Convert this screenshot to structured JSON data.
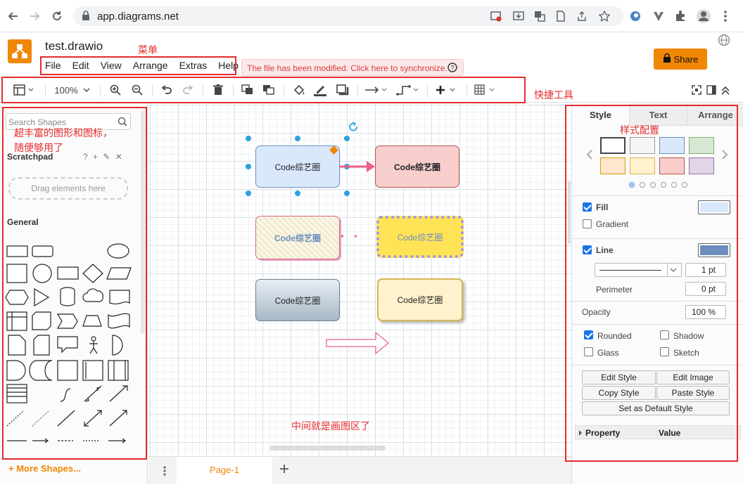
{
  "browser": {
    "url": "app.diagrams.net"
  },
  "app": {
    "file_title": "test.drawio",
    "menu": [
      "File",
      "Edit",
      "View",
      "Arrange",
      "Extras",
      "Help"
    ],
    "sync_message": "The file has been modified. Click here to synchronize.",
    "share_label": "Share",
    "accent_color": "#f08705"
  },
  "toolbar": {
    "zoom": "100%"
  },
  "sidebar": {
    "search_placeholder": "Search Shapes",
    "scratchpad_label": "Scratchpad",
    "scratchpad_actions": "? + ✎ ✕",
    "drag_hint": "Drag elements here",
    "general_label": "General",
    "more_shapes": "+ More Shapes..."
  },
  "canvas": {
    "shape_text": "Code综艺圈",
    "page_tab": "Page-1"
  },
  "panel": {
    "tabs": [
      "Style",
      "Text",
      "Arrange"
    ],
    "swatches_row1": [
      "#ffffff",
      "#f5f5f5",
      "#dae8fc",
      "#d5e8d4"
    ],
    "swatches_row2": [
      "#ffe6cc",
      "#fff2cc",
      "#f8cecc",
      "#e1d5e7"
    ],
    "fill_label": "Fill",
    "fill_color": "#dae8fc",
    "gradient_label": "Gradient",
    "line_label": "Line",
    "line_color": "#6c8ebf",
    "line_width": "1 pt",
    "perimeter_label": "Perimeter",
    "perimeter_value": "0 pt",
    "opacity_label": "Opacity",
    "opacity_value": "100 %",
    "rounded_label": "Rounded",
    "shadow_label": "Shadow",
    "glass_label": "Glass",
    "sketch_label": "Sketch",
    "edit_style": "Edit Style",
    "edit_image": "Edit Image",
    "copy_style": "Copy Style",
    "paste_style": "Paste Style",
    "set_default": "Set as Default Style",
    "property_header": "Property",
    "value_header": "Value"
  },
  "annotations": {
    "menu": "菜单",
    "toolbar": "快捷工具",
    "shapes_line1": "超丰富的图形和图标，",
    "shapes_line2": "随便够用了",
    "style": "样式配置",
    "canvas": "中间就是画图区了"
  }
}
